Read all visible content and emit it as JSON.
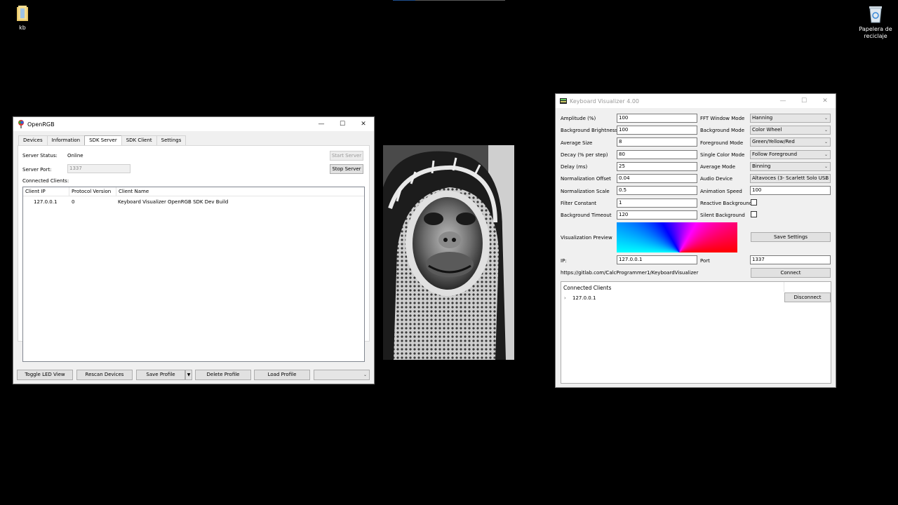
{
  "desktop": {
    "icons": [
      {
        "label": "kb"
      },
      {
        "label": "Papelera de reciclaje"
      }
    ]
  },
  "openrgb": {
    "title": "OpenRGB",
    "tabs": [
      "Devices",
      "Information",
      "SDK Server",
      "SDK Client",
      "Settings"
    ],
    "active_tab": "SDK Server",
    "server_status_label": "Server Status:",
    "server_status_value": "Online",
    "server_port_label": "Server Port:",
    "server_port_value": "1337",
    "connected_clients_label": "Connected Clients:",
    "start_server": "Start Server",
    "stop_server": "Stop Server",
    "columns": [
      "Client IP",
      "Protocol Version",
      "Client Name"
    ],
    "rows": [
      {
        "ip": "127.0.0.1",
        "protocol": "0",
        "name": "Keyboard Visualizer OpenRGB SDK Dev Build"
      }
    ],
    "bottom_buttons": {
      "toggle": "Toggle LED View",
      "rescan": "Rescan Devices",
      "save": "Save Profile",
      "delete": "Delete Profile",
      "load": "Load Profile"
    }
  },
  "kv": {
    "title": "Keyboard Visualizer 4.00",
    "left": [
      {
        "label": "Amplitude (%)",
        "value": "100"
      },
      {
        "label": "Background Brightness",
        "value": "100"
      },
      {
        "label": "Average Size",
        "value": "8"
      },
      {
        "label": "Decay (% per step)",
        "value": "80"
      },
      {
        "label": "Delay (ms)",
        "value": "25"
      },
      {
        "label": "Normalization Offset",
        "value": "0.04"
      },
      {
        "label": "Normalization Scale",
        "value": "0.5"
      },
      {
        "label": "Filter Constant",
        "value": "1"
      },
      {
        "label": "Background Timeout",
        "value": "120"
      }
    ],
    "right": [
      {
        "label": "FFT Window Mode",
        "value": "Hanning"
      },
      {
        "label": "Background Mode",
        "value": "Color Wheel"
      },
      {
        "label": "Foreground Mode",
        "value": "Green/Yellow/Red"
      },
      {
        "label": "Single Color Mode",
        "value": "Follow Foreground"
      },
      {
        "label": "Average Mode",
        "value": "Binning"
      },
      {
        "label": "Audio Device",
        "value": "Altavoces (3- Scarlett Solo USB"
      },
      {
        "label": "Animation Speed",
        "value": "100"
      },
      {
        "label": "Reactive Background"
      },
      {
        "label": "Silent Background"
      }
    ],
    "preview_label": "Visualization Preview",
    "save_settings": "Save Settings",
    "ip_label": "IP:",
    "ip_value": "127.0.0.1",
    "port_label": "Port",
    "port_value": "1337",
    "url": "https://gitlab.com/CalcProgrammer1/KeyboardVisualizer",
    "connect": "Connect",
    "clients_header": "Connected Clients",
    "client_ip": "127.0.0.1",
    "disconnect": "Disconnect"
  },
  "colors": {
    "desktop_bg": "#000000",
    "window_bg": "#f0f0f0",
    "button_bg": "#e1e1e1"
  }
}
